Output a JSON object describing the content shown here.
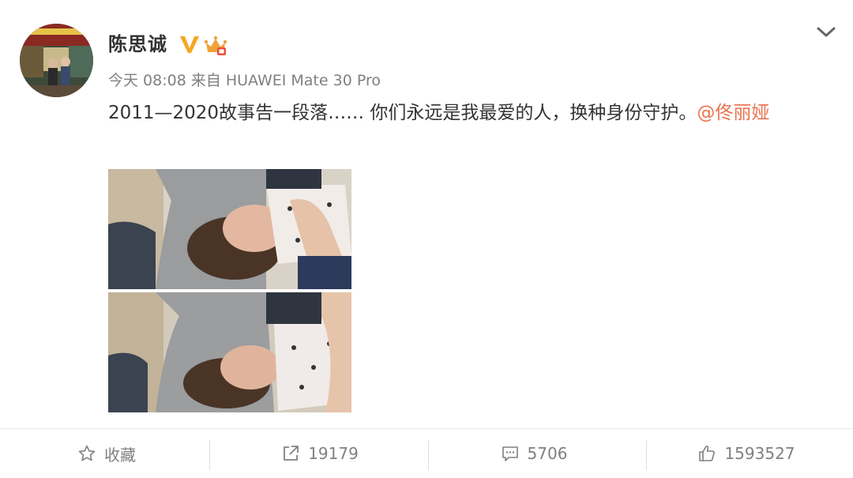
{
  "post": {
    "author": "陈思诚",
    "time": "今天 08:08",
    "source_prefix": "来自",
    "source_device": "HUAWEI Mate 30 Pro",
    "text": "2011—2020故事告一段落…… 你们永远是我最爱的人，换种身份守护。",
    "mention": "@佟丽娅",
    "badges": [
      "verified-v-icon",
      "vip-crown-icon"
    ]
  },
  "actions": {
    "favorite_label": "收藏",
    "repost_count": "19179",
    "comment_count": "5706",
    "like_count": "1593527"
  },
  "colors": {
    "mention": "#eb7350",
    "verified": "#f5a623",
    "meta": "#808080",
    "text": "#333333"
  }
}
